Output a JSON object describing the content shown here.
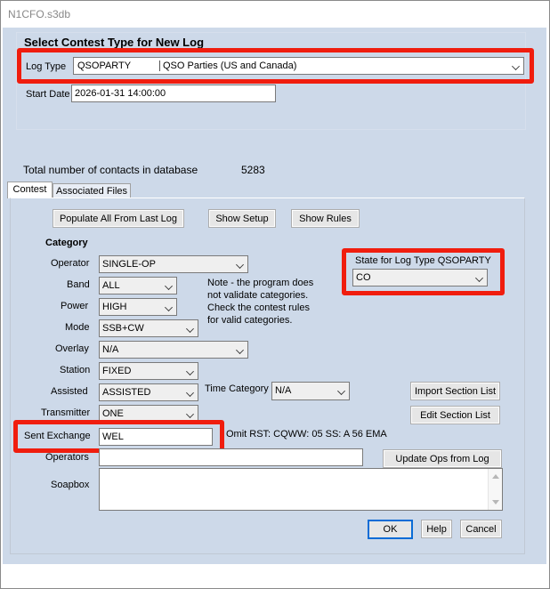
{
  "window": {
    "title": "N1CFO.s3db"
  },
  "header": {
    "heading": "Select Contest Type for New Log",
    "log_type_label": "Log Type",
    "log_type_code": "QSOPARTY",
    "log_type_desc": "QSO Parties (US and Canada)",
    "start_date_label": "Start Date",
    "start_date_value": "2026-01-31 14:00:00"
  },
  "totals": {
    "label": "Total number of contacts in database",
    "value": "5283"
  },
  "tabs": [
    {
      "label": "Contest"
    },
    {
      "label": "Associated Files"
    }
  ],
  "buttons": {
    "populate": "Populate All From Last Log",
    "show_setup": "Show Setup",
    "show_rules": "Show Rules",
    "import_section": "Import Section List",
    "edit_section": "Edit Section List",
    "update_ops": "Update Ops from Log",
    "ok": "OK",
    "help": "Help",
    "cancel": "Cancel"
  },
  "category": {
    "title": "Category",
    "operator": {
      "label": "Operator",
      "value": "SINGLE-OP"
    },
    "band": {
      "label": "Band",
      "value": "ALL"
    },
    "power": {
      "label": "Power",
      "value": "HIGH"
    },
    "mode": {
      "label": "Mode",
      "value": "SSB+CW"
    },
    "overlay": {
      "label": "Overlay",
      "value": "N/A"
    },
    "station": {
      "label": "Station",
      "value": "FIXED"
    },
    "assisted": {
      "label": "Assisted",
      "value": "ASSISTED"
    },
    "transmitter": {
      "label": "Transmitter",
      "value": "ONE"
    },
    "time_category": {
      "label": "Time Category",
      "value": "N/A"
    }
  },
  "note": {
    "line1": "Note -  the program does",
    "line2": "not validate categories.",
    "line3": "Check the contest rules",
    "line4": "for valid categories."
  },
  "state": {
    "label": "State for Log Type QSOPARTY",
    "value": "CO"
  },
  "sent_exchange": {
    "label": "Sent Exchange",
    "value": "WEL",
    "hint": "Omit RST:  CQWW: 05  SS: A 56 EMA"
  },
  "operators": {
    "label": "Operators",
    "value": ""
  },
  "soapbox": {
    "label": "Soapbox",
    "value": ""
  },
  "colors": {
    "highlight": "#f01d0e",
    "client_bg": "#cdd9e9",
    "focus": "#0a6cd6"
  }
}
